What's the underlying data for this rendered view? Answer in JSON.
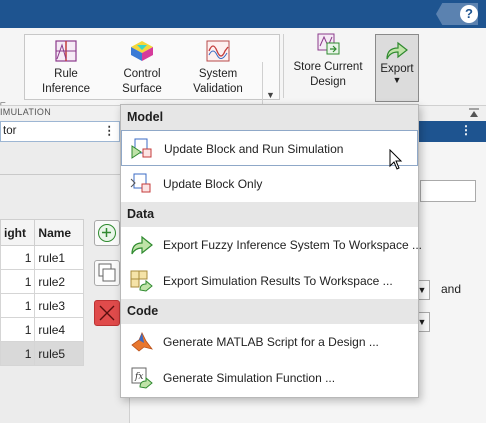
{
  "topbar": {
    "help_label": "?"
  },
  "ribbon": {
    "sections": {
      "simulation": "IMULATION"
    },
    "buttons": [
      {
        "id": "rule-inference",
        "label": "Rule Inference",
        "icon": "rule-inference-icon"
      },
      {
        "id": "control-surface",
        "label": "Control Surface",
        "icon": "control-surface-icon"
      },
      {
        "id": "system-validation",
        "label": "System Validation",
        "icon": "system-validation-icon"
      },
      {
        "id": "store-current-design",
        "label": "Store Current Design",
        "icon": "store-design-icon"
      },
      {
        "id": "export",
        "label": "Export",
        "icon": "export-arrow-icon"
      }
    ],
    "gallery_arrow": "▼",
    "export_arrow": "▼"
  },
  "doc": {
    "tab_label": "tor",
    "tab_menu": "⋮",
    "bar_menu": "⋮"
  },
  "rules_table": {
    "headers": [
      "ight",
      "Name"
    ],
    "rows": [
      {
        "weight": "1",
        "name": "rule1"
      },
      {
        "weight": "1",
        "name": "rule2"
      },
      {
        "weight": "1",
        "name": "rule3"
      },
      {
        "weight": "1",
        "name": "rule4"
      },
      {
        "weight": "1",
        "name": "rule5",
        "selected": true
      }
    ]
  },
  "right_panel": {
    "and_label": "and",
    "dropdown_arrow": "▼"
  },
  "export_menu": {
    "sections": [
      {
        "title": "Model",
        "items": [
          {
            "label": "Update Block and Run Simulation",
            "icon": "update-run-simulation-icon",
            "hover": true
          },
          {
            "label": "Update Block Only",
            "icon": "update-block-icon"
          }
        ]
      },
      {
        "title": "Data",
        "items": [
          {
            "label": "Export Fuzzy Inference System To Workspace ...",
            "icon": "export-fis-icon"
          },
          {
            "label": "Export Simulation Results To Workspace ...",
            "icon": "export-results-icon"
          }
        ]
      },
      {
        "title": "Code",
        "items": [
          {
            "label": "Generate MATLAB Script for a Design ...",
            "icon": "matlab-script-icon"
          },
          {
            "label": "Generate Simulation Function ...",
            "icon": "simulation-function-icon"
          }
        ]
      }
    ]
  },
  "colors": {
    "title_bar": "#1e5490",
    "accent_green": "#2f8a2f",
    "delete_red": "#e04b4b",
    "menu_section_bg": "#e6e6e6"
  }
}
